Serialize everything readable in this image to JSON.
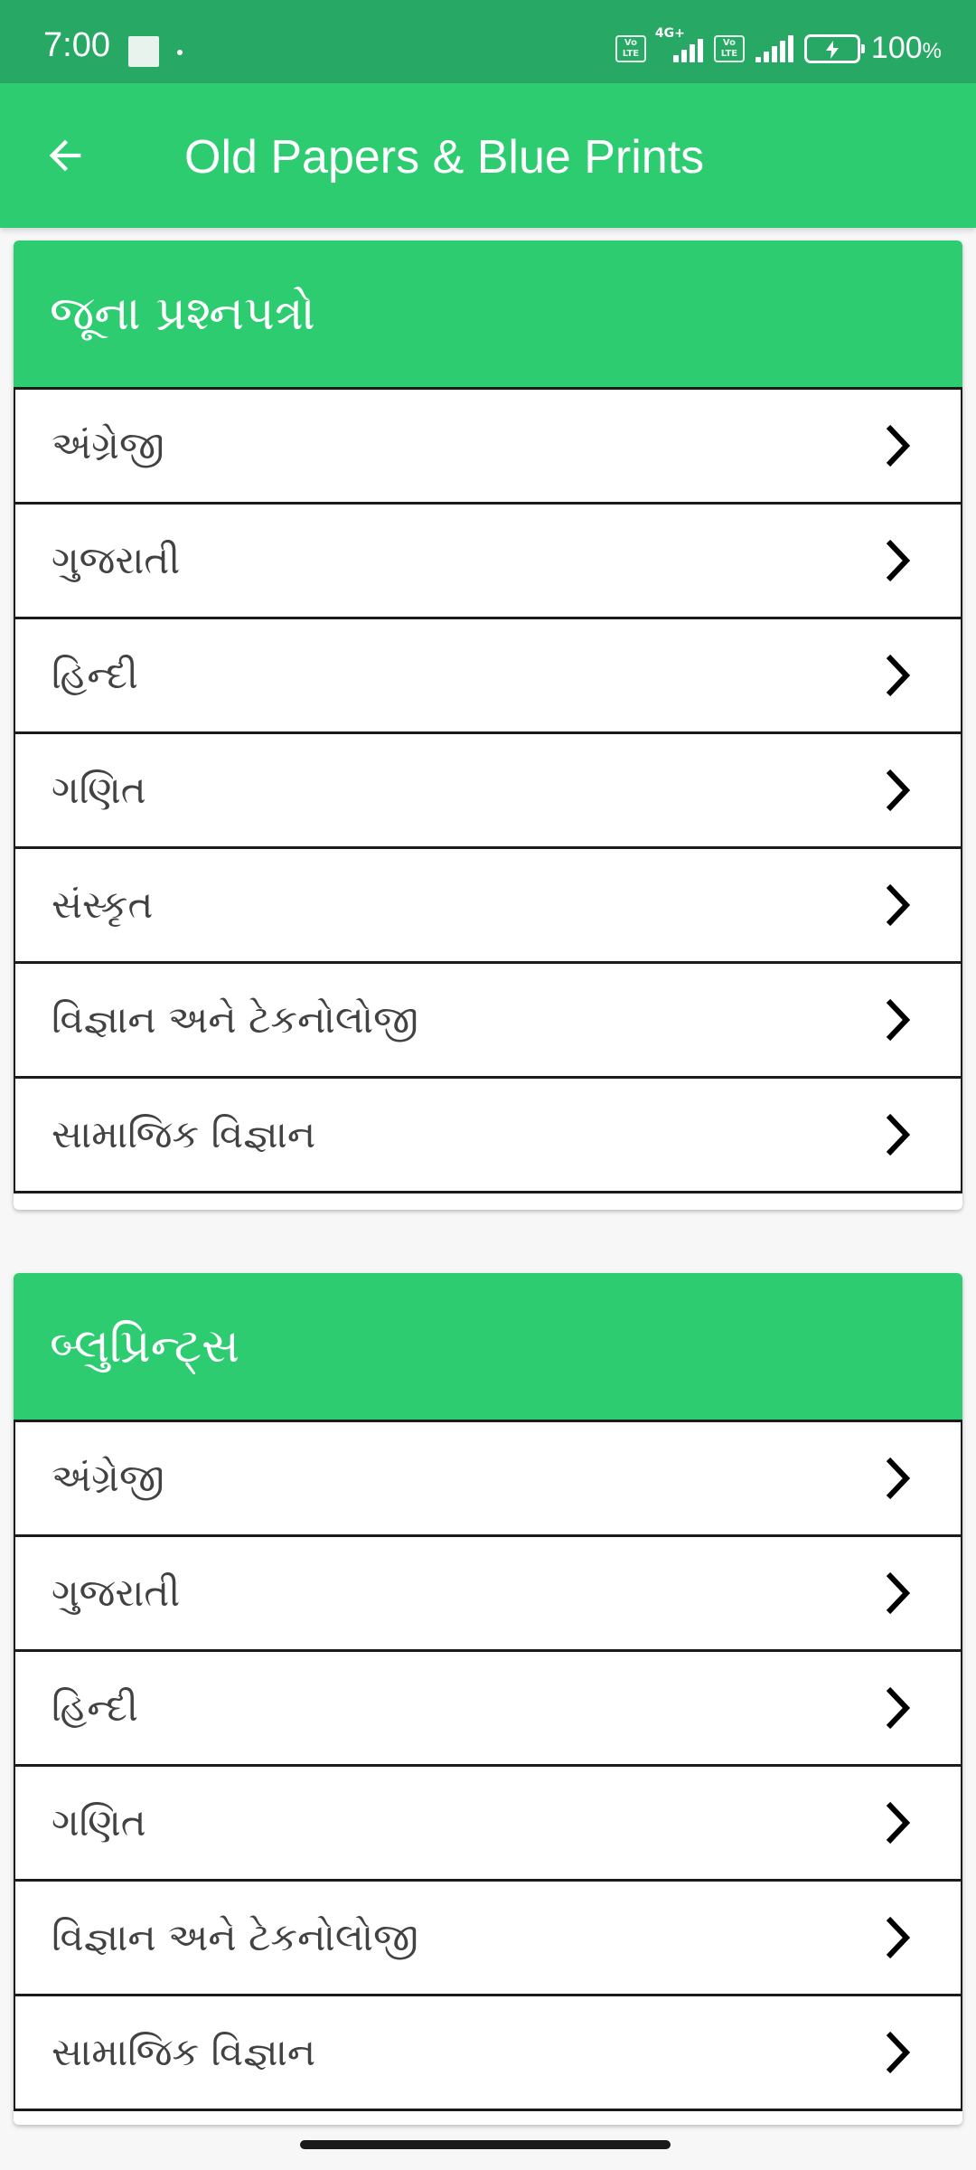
{
  "status_bar": {
    "time": "7:00",
    "network": "4G+",
    "volte": "Vo LTE",
    "battery": "100",
    "battery_unit": "%"
  },
  "app_bar": {
    "title": "Old Papers & Blue Prints",
    "back_icon": "arrow-back-icon"
  },
  "sections": [
    {
      "title": "જૂના પ્રશ્નપત્રો",
      "items": [
        "અંગ્રેજી",
        "ગુજરાતી",
        "હિન્દી",
        "ગણિત",
        "સંસ્કૃત",
        "વિજ્ઞાન અને ટેકનોલોજી",
        "સામાજિક વિજ્ઞાન"
      ]
    },
    {
      "title": "બ્લુપ્રિન્ટ્સ",
      "items": [
        "અંગ્રેજી",
        "ગુજરાતી",
        "હિન્દી",
        "ગણિત",
        "વિજ્ઞાન અને ટેકનોલોજી",
        "સામાજિક વિજ્ઞાન"
      ]
    }
  ],
  "colors": {
    "status_bar": "#27a864",
    "primary": "#2ecc71",
    "text": "#424242",
    "background": "#f7f7f7"
  }
}
